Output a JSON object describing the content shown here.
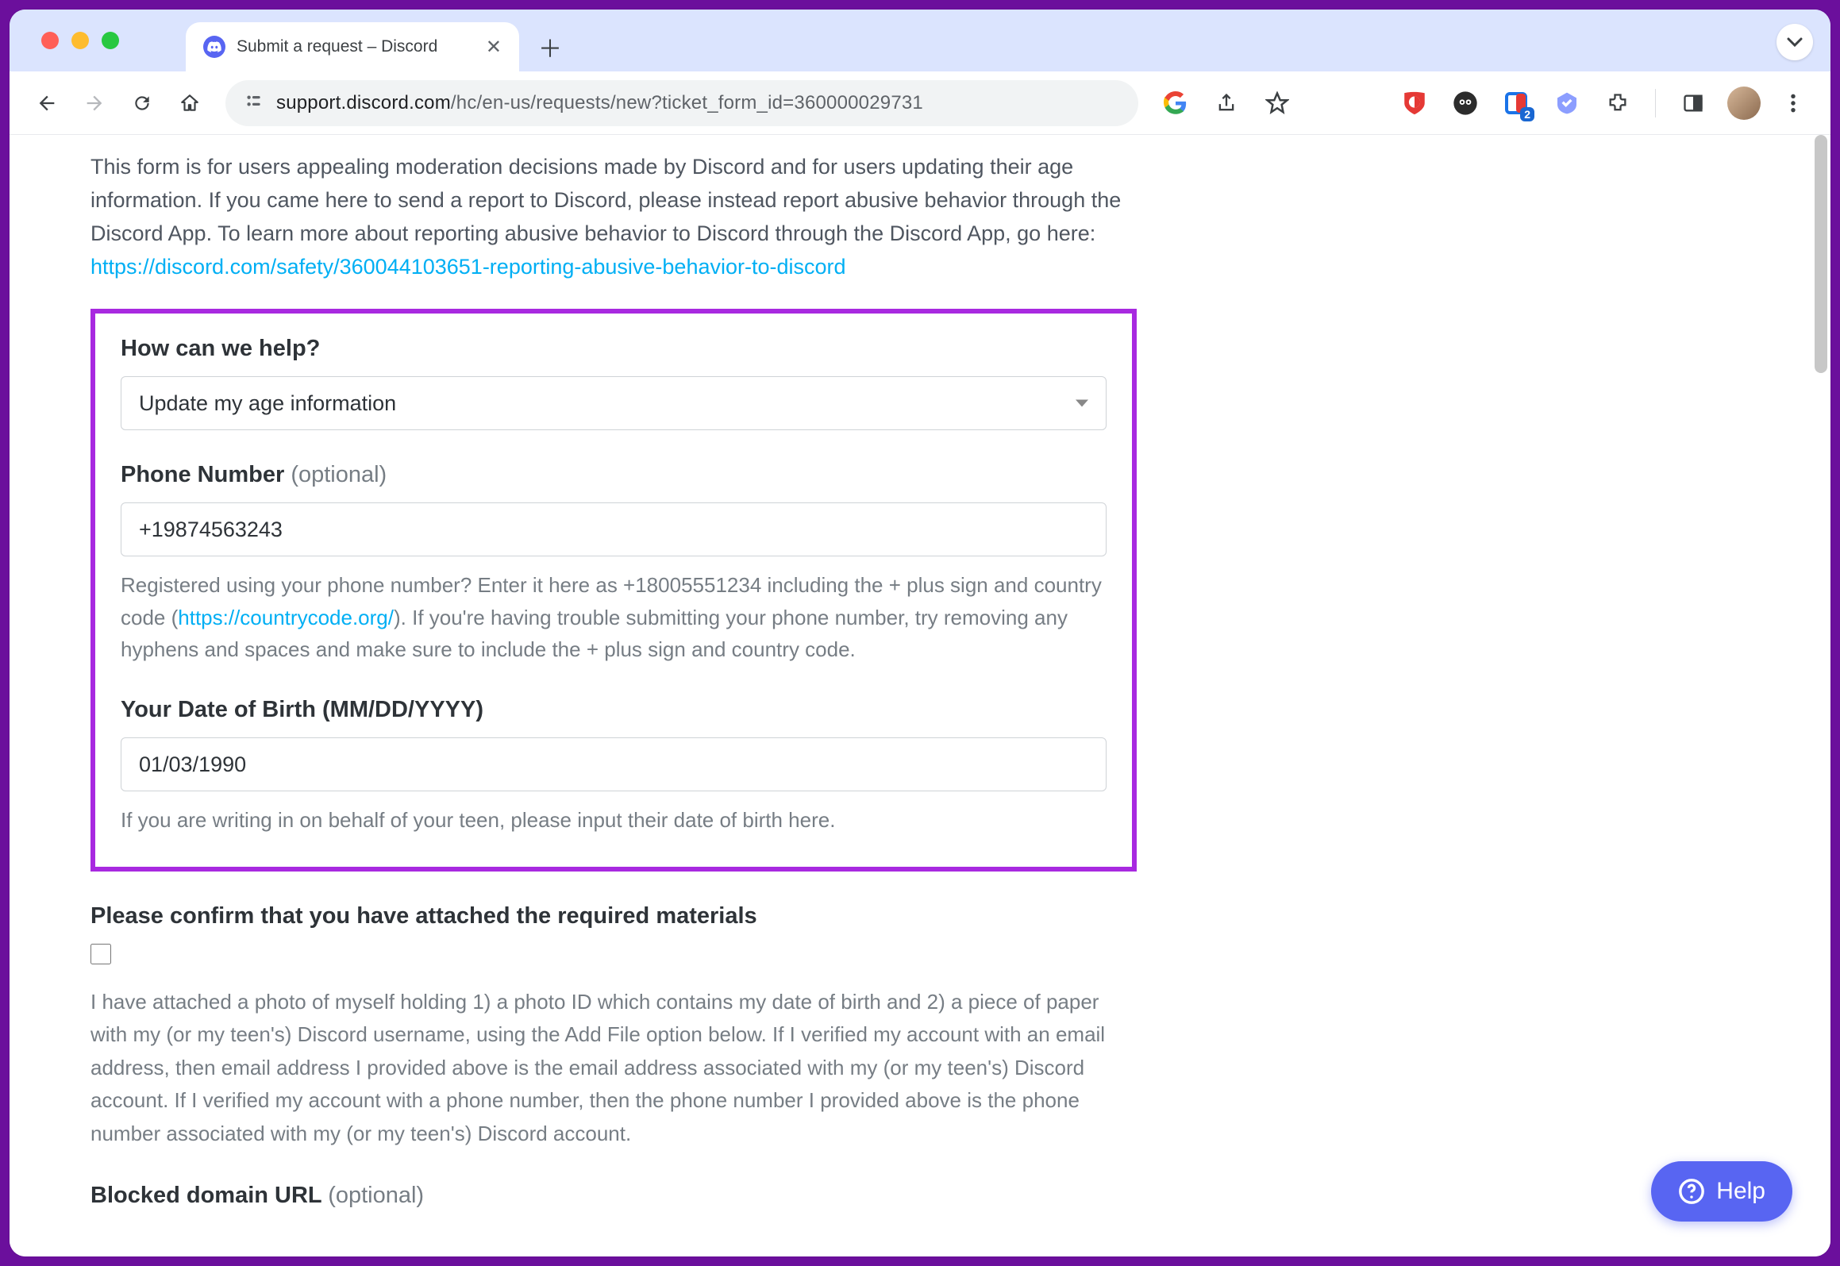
{
  "browser": {
    "tab_title": "Submit a request – Discord",
    "url_domain": "support.discord.com",
    "url_path": "/hc/en-us/requests/new?ticket_form_id=360000029731",
    "ext_badge": "2"
  },
  "intro": {
    "text_prefix": "This form is for users appealing moderation decisions made by Discord and for users updating their age information. If you came here to send a report to Discord, please instead report abusive behavior through the Discord App. To learn more about reporting abusive behavior to Discord through the Discord App, go here: ",
    "link": "https://discord.com/safety/360044103651-reporting-abusive-behavior-to-discord"
  },
  "form": {
    "help_label": "How can we help?",
    "help_value": "Update my age information",
    "phone_label": "Phone Number",
    "optional": "(optional)",
    "phone_value": "+19874563243",
    "phone_help_prefix": "Registered using your phone number? Enter it here as +18005551234 including the + plus sign and country code (",
    "phone_help_link": "https://countrycode.org/",
    "phone_help_suffix": "). If you're having trouble submitting your phone number, try removing any hyphens and spaces and make sure to include the + plus sign and country code.",
    "dob_label": "Your Date of Birth (MM/DD/YYYY)",
    "dob_value": "01/03/1990",
    "dob_help": "If you are writing in on behalf of your teen, please input their date of birth here.",
    "confirm_label": "Please confirm that you have attached the required materials",
    "confirm_text": "I have attached a photo of myself holding 1) a photo ID which contains my date of birth and 2) a piece of paper with my (or my teen's) Discord username, using the Add File option below. If I verified my account with an email address, then email address I provided above is the email address associated with my (or my teen's) Discord account. If I verified my account with a phone number, then the phone number I provided above is the phone number associated with my (or my teen's) Discord account.",
    "blocked_label": "Blocked domain URL"
  },
  "widget": {
    "label": "Help"
  }
}
